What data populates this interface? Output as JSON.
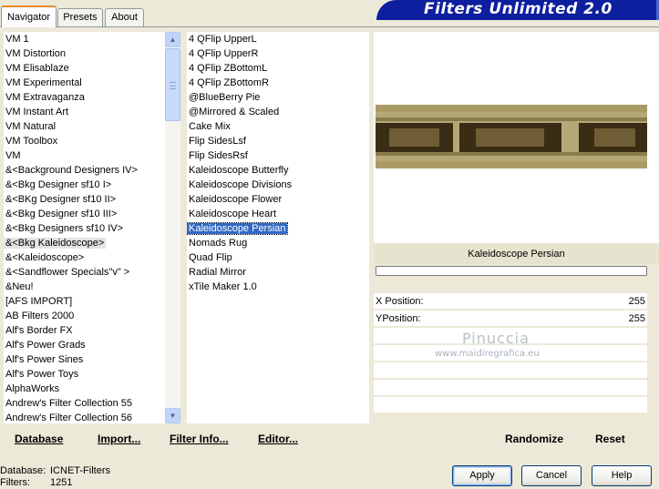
{
  "window": {
    "title": "Filters Unlimited 2.0"
  },
  "tabs": [
    {
      "label": "Navigator",
      "active": true
    },
    {
      "label": "Presets",
      "active": false
    },
    {
      "label": "About",
      "active": false
    }
  ],
  "categories": {
    "items": [
      "VM 1",
      "VM Distortion",
      "VM Elisablaze",
      "VM Experimental",
      "VM Extravaganza",
      "VM Instant Art",
      "VM Natural",
      "VM Toolbox",
      "VM",
      "&<Background Designers IV>",
      "&<Bkg Designer sf10 I>",
      "&<BKg Designer sf10 II>",
      "&<Bkg Designer sf10 III>",
      "&<Bkg Designers sf10 IV>",
      "&<Bkg Kaleidoscope>",
      "&<Kaleidoscope>",
      "&<Sandflower Specials\"v\" >",
      "&Neu!",
      "[AFS IMPORT]",
      "AB Filters 2000",
      "Alf's Border FX",
      "Alf's Power Grads",
      "Alf's Power Sines",
      "Alf's Power Toys",
      "AlphaWorks",
      "Andrew's Filter Collection 55",
      "Andrew's Filter Collection 56"
    ],
    "selected_index": 14
  },
  "filters": {
    "items": [
      "4 QFlip UpperL",
      "4 QFlip UpperR",
      "4 QFlip ZBottomL",
      "4 QFlip ZBottomR",
      "@BlueBerry Pie",
      "@Mirrored & Scaled",
      "Cake Mix",
      "Flip SidesLsf",
      "Flip SidesRsf",
      "Kaleidoscope Butterfly",
      "Kaleidoscope Divisions",
      "Kaleidoscope Flower",
      "Kaleidoscope Heart",
      "Kaleidoscope Persian",
      "Nomads Rug",
      "Quad Flip",
      "Radial Mirror",
      "xTile Maker 1.0"
    ],
    "selected_index": 13
  },
  "preview": {
    "filter_name": "Kaleidoscope Persian",
    "progress": 0
  },
  "params": [
    {
      "label": "X Position:",
      "value": "255"
    },
    {
      "label": "YPosition:",
      "value": "255"
    }
  ],
  "watermark": {
    "name": "Pinuccia",
    "url": "www.maidiregrafica.eu"
  },
  "toolbar": {
    "database_label": "Database",
    "import_label": "Import...",
    "filter_info_label": "Filter Info...",
    "editor_label": "Editor...",
    "randomize_label": "Randomize",
    "reset_label": "Reset"
  },
  "footer": {
    "database_caption": "Database:",
    "database_value": "ICNET-Filters",
    "filters_caption": "Filters:",
    "filters_value": "1251",
    "apply_label": "Apply",
    "cancel_label": "Cancel",
    "help_label": "Help"
  },
  "colors": {
    "title_bar": "#0d1f9e",
    "selection": "#316ac5",
    "preview_tone": "#b5a877"
  }
}
